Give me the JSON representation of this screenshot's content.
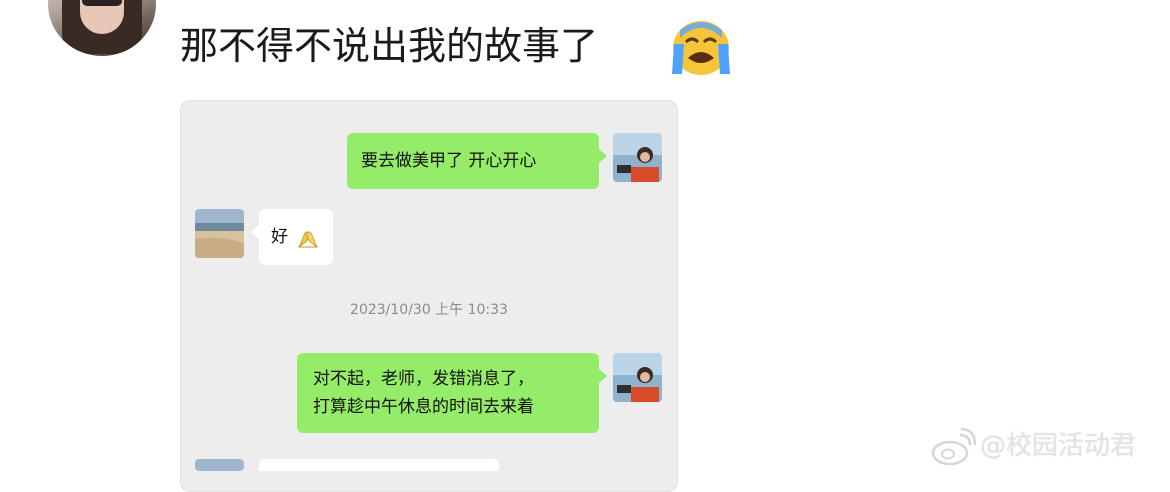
{
  "post": {
    "caption": "那不得不说出我的故事了",
    "caption_emoji": "loudly-crying-face"
  },
  "chat": {
    "messages": [
      {
        "side": "right",
        "text": "要去做美甲了  开心开心"
      },
      {
        "side": "left",
        "text": "好",
        "emoji": "folded-hands-yellow"
      },
      {
        "side": "right",
        "lines": [
          "对不起，老师，发错消息了，",
          "打算趁中午休息的时间去来着"
        ]
      }
    ],
    "timestamp": "2023/10/30 上午 10:33"
  },
  "watermark": {
    "text": "@校园活动君"
  },
  "colors": {
    "green_bubble": "#95ec69",
    "chat_background": "#ededed"
  }
}
